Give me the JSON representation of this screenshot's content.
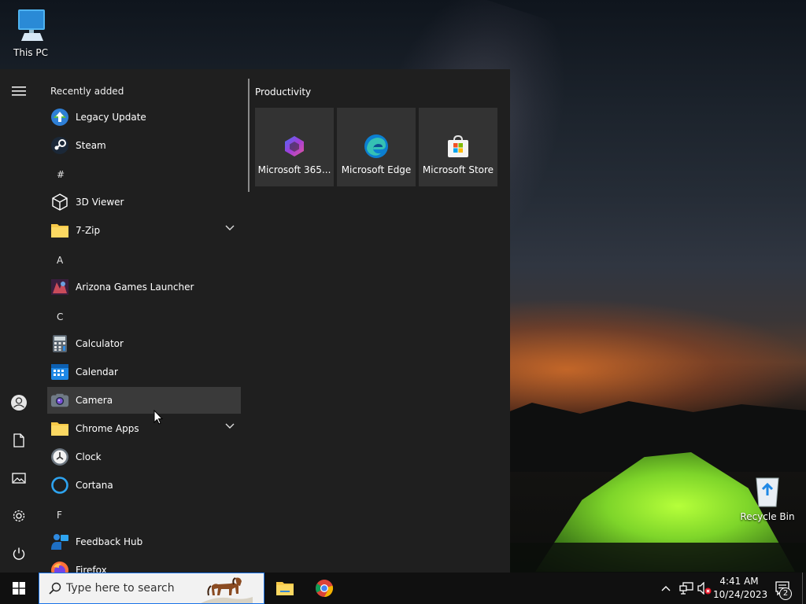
{
  "desktop": {
    "icons": [
      {
        "label": "This PC"
      },
      {
        "label": "Recycle Bin"
      }
    ]
  },
  "start_menu": {
    "recently_added_heading": "Recently added",
    "recently_added": [
      {
        "label": "Legacy Update"
      },
      {
        "label": "Steam"
      }
    ],
    "letters": [
      "#",
      "A",
      "C",
      "F"
    ],
    "apps": [
      {
        "label": "3D Viewer"
      },
      {
        "label": "7-Zip"
      },
      {
        "label": "Arizona Games Launcher"
      },
      {
        "label": "Calculator"
      },
      {
        "label": "Calendar"
      },
      {
        "label": "Camera"
      },
      {
        "label": "Chrome Apps"
      },
      {
        "label": "Clock"
      },
      {
        "label": "Cortana"
      },
      {
        "label": "Feedback Hub"
      },
      {
        "label": "Firefox"
      }
    ],
    "tiles_heading": "Productivity",
    "tiles": [
      {
        "label": "Microsoft 365..."
      },
      {
        "label": "Microsoft Edge"
      },
      {
        "label": "Microsoft Store"
      }
    ]
  },
  "taskbar": {
    "search_placeholder": "Type here to search",
    "time": "4:41 AM",
    "date": "10/24/2023",
    "notification_count": "2"
  },
  "colors": {
    "start_bg": "#1f1f1f",
    "tile_bg": "#333333",
    "hover_bg": "#3a3a3a",
    "taskbar_bg": "#101010",
    "accent": "#1a73e8"
  }
}
